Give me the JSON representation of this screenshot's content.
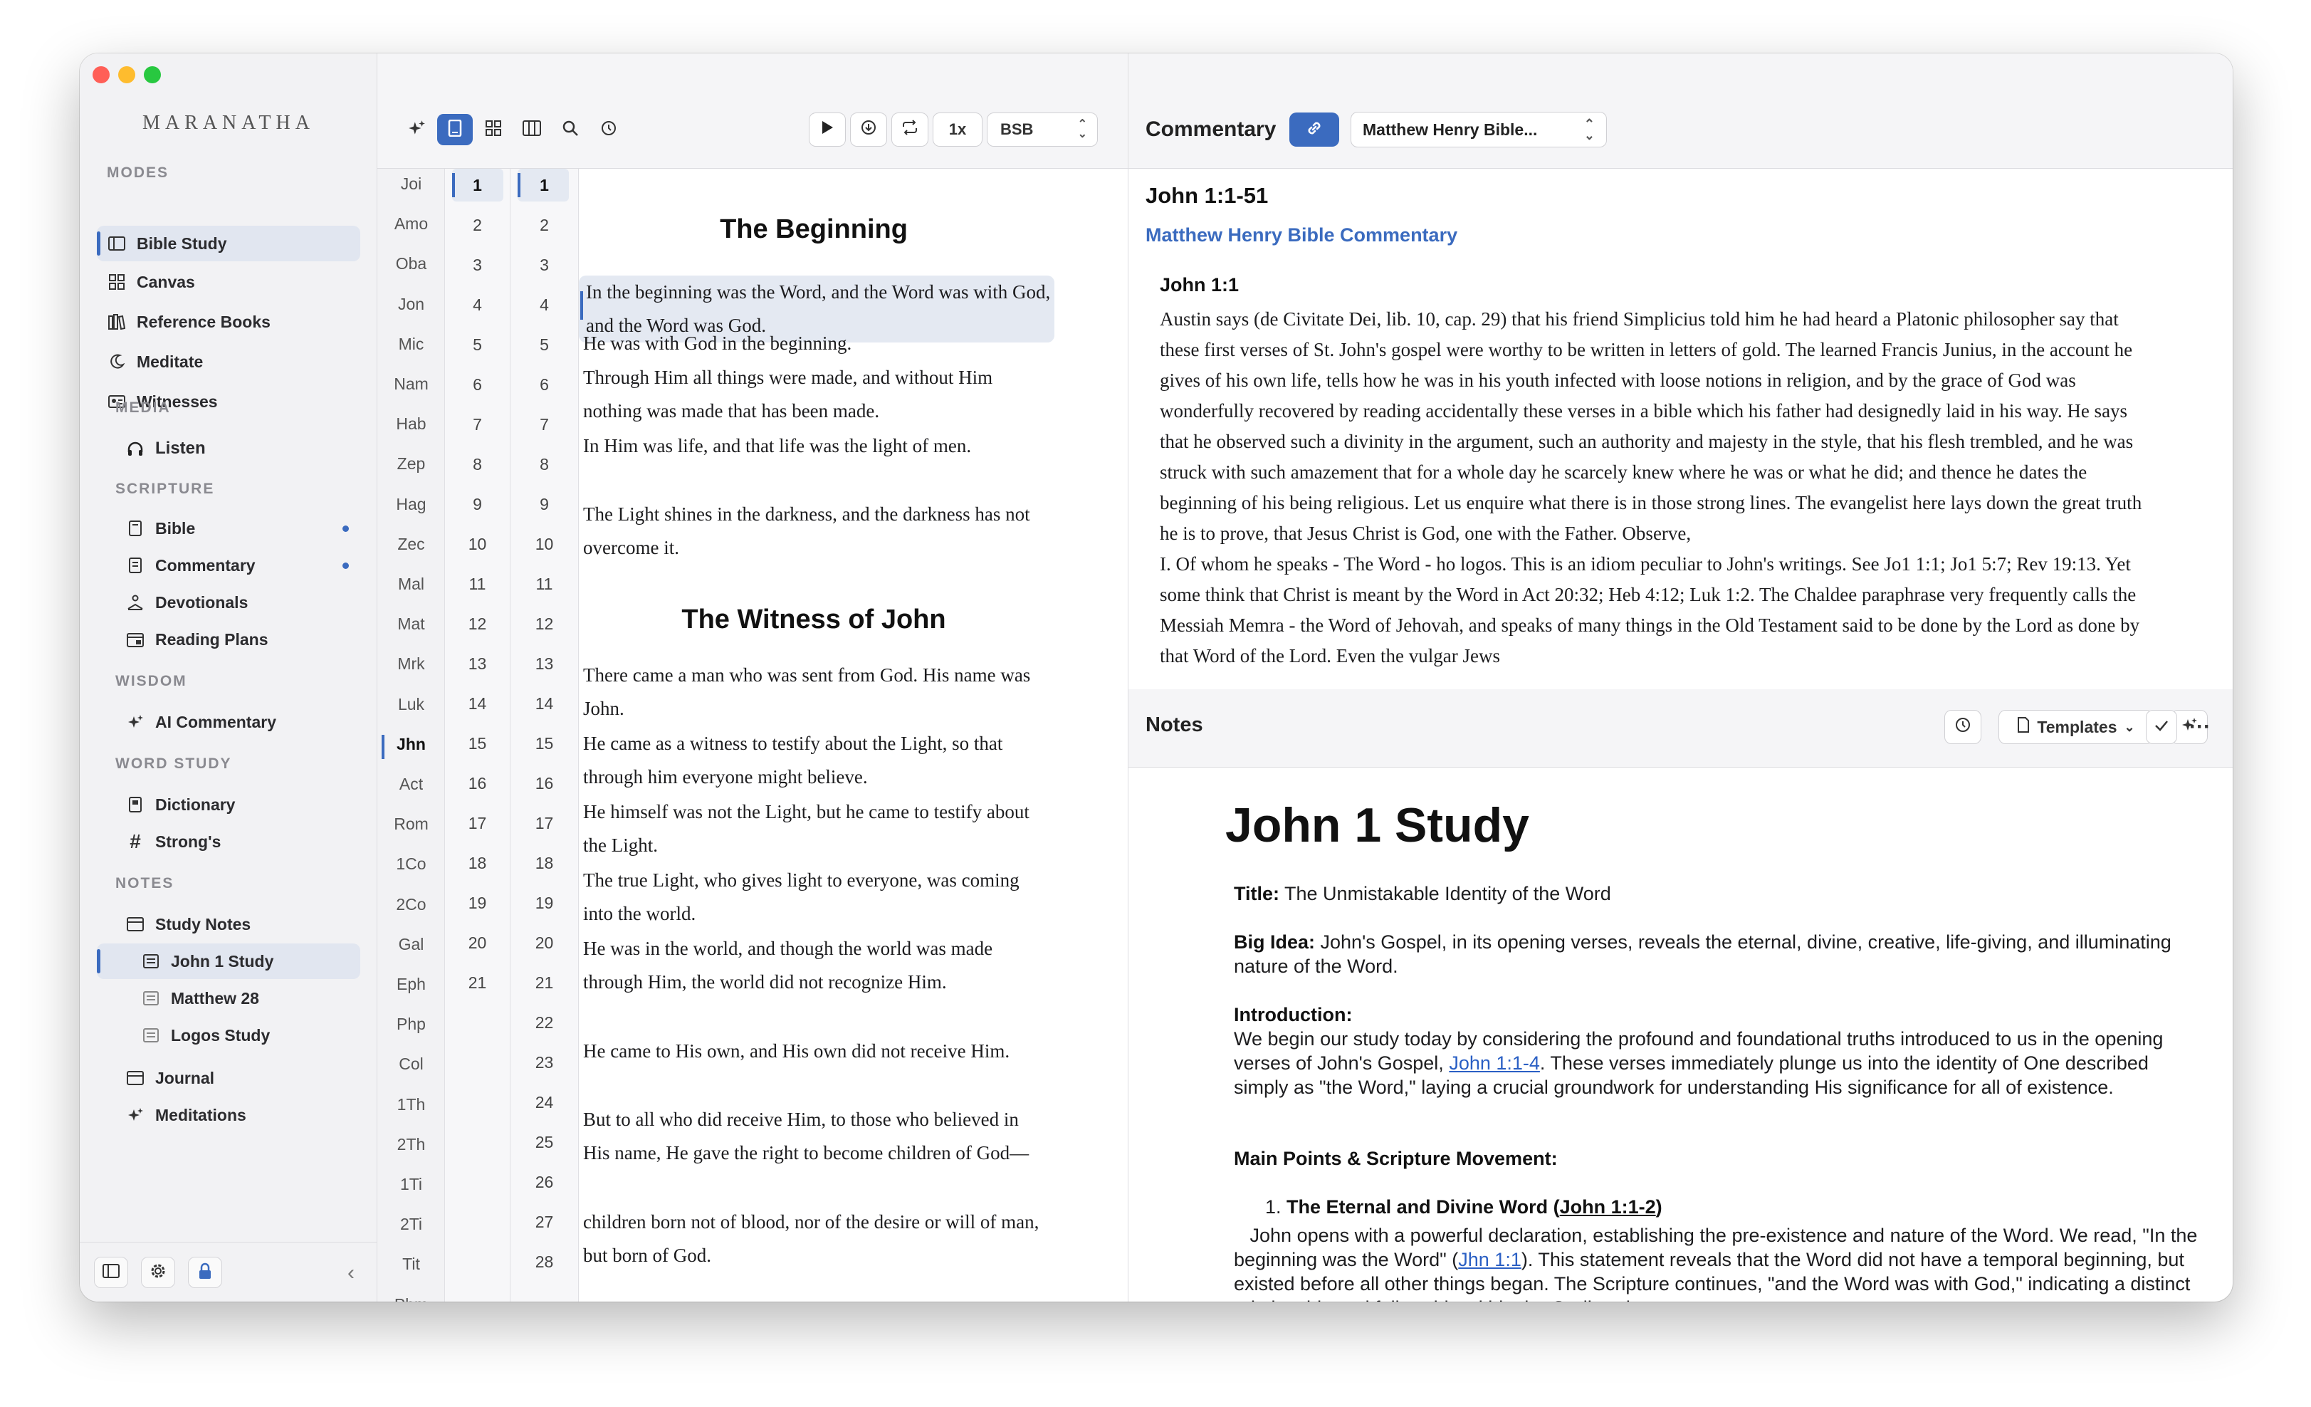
{
  "app": {
    "brand": "MARANATHA"
  },
  "sidebar": {
    "sections": {
      "modes": "MODES",
      "media": "MEDIA",
      "scripture": "SCRIPTURE",
      "wisdom": "WISDOM",
      "word_study": "WORD STUDY",
      "notes": "NOTES"
    },
    "modes": [
      "Bible Study",
      "Canvas",
      "Reference Books",
      "Meditate",
      "Witnesses"
    ],
    "media": [
      "Listen"
    ],
    "scripture": [
      "Bible",
      "Commentary",
      "Devotionals",
      "Reading Plans"
    ],
    "wisdom": [
      "AI Commentary"
    ],
    "word_study": [
      "Dictionary",
      "Strong's"
    ],
    "notes": {
      "folder": "Study Notes",
      "children": [
        "John 1 Study",
        "Matthew 28",
        "Logos Study"
      ],
      "others": [
        "Journal",
        "Meditations"
      ]
    }
  },
  "reader": {
    "speed": "1x",
    "translation": "BSB",
    "books": [
      "Joi",
      "Amo",
      "Oba",
      "Jon",
      "Mic",
      "Nam",
      "Hab",
      "Zep",
      "Hag",
      "Zec",
      "Mal",
      "Mat",
      "Mrk",
      "Luk",
      "Jhn",
      "Act",
      "Rom",
      "1Co",
      "2Co",
      "Gal",
      "Eph",
      "Php",
      "Col",
      "1Th",
      "2Th",
      "1Ti",
      "2Ti",
      "Tit",
      "Phm"
    ],
    "active_book": "Jhn",
    "chapters": [
      "1",
      "2",
      "3",
      "4",
      "5",
      "6",
      "7",
      "8",
      "9",
      "10",
      "11",
      "12",
      "13",
      "14",
      "15",
      "16",
      "17",
      "18",
      "19",
      "20",
      "21"
    ],
    "verse_numbers": [
      "1",
      "2",
      "3",
      "4",
      "5",
      "6",
      "7",
      "8",
      "9",
      "10",
      "11",
      "12",
      "13",
      "14",
      "15",
      "16",
      "17",
      "18",
      "19",
      "20",
      "21",
      "22",
      "23",
      "24",
      "25",
      "26",
      "27",
      "28"
    ],
    "headings": [
      "The Beginning",
      "The Witness of John"
    ],
    "verses": [
      "In the beginning was the Word, and the Word was with God, and the Word was God.",
      "He was with God in the beginning.",
      "Through Him all things were made, and without Him nothing was made that has been made.",
      "In Him was life, and that life was the light of men.",
      "The Light shines in the darkness, and the darkness has not overcome it.",
      "There came a man who was sent from God. His name was John.",
      "He came as a witness to testify about the Light, so that through him everyone might believe.",
      "He himself was not the Light, but he came to testify about the Light.",
      "The true Light, who gives light to everyone, was coming into the world.",
      "He was in the world, and though the world was made through Him, the world did not recognize Him.",
      "He came to His own, and His own did not receive Him.",
      "But to all who did receive Him, to those who believed in His name, He gave the right to become children of God—",
      "children born not of blood, nor of the desire or will of man, but born of God."
    ]
  },
  "commentary": {
    "title": "Commentary",
    "source_select": "Matthew Henry Bible...",
    "reference": "John 1:1-51",
    "source_name": "Matthew Henry Bible Commentary",
    "verse_heading": "John 1:1",
    "text": "Austin says (de Civitate Dei, lib. 10, cap. 29) that his friend Simplicius told him he had heard a Platonic philosopher say that these first verses of St. John's gospel were worthy to be written in letters of gold. The learned Francis Junius, in the account he gives of his own life, tells how he was in his youth infected with loose notions in religion, and by the grace of God was wonderfully recovered by reading accidentally these verses in a bible which his father had designedly laid in his way. He says that he observed such a divinity in the argument, such an authority and majesty in the style, that his flesh trembled, and he was struck with such amazement that for a whole day he scarcely knew where he was or what he did; and thence he dates the beginning of his being religious. Let us enquire what there is in those strong lines. The evangelist here lays down the great truth he is to prove, that Jesus Christ is God, one with the Father. Observe,",
    "text2": "I. Of whom he speaks - The Word - ho logos. This is an idiom peculiar to John's writings. See Jo1 1:1; Jo1 5:7; Rev 19:13. Yet some think that Christ is meant by the Word in Act 20:32; Heb 4:12; Luk 1:2. The Chaldee paraphrase very frequently calls the Messiah Memra - the Word of Jehovah, and speaks of many things in the Old Testament said to be done by the Lord as done by that Word of the Lord. Even the vulgar Jews"
  },
  "notes": {
    "title": "Notes",
    "templates_label": "Templates",
    "doc_title": "John 1 Study",
    "title_label": "Title:",
    "title_value": " The Unmistakable Identity of the Word",
    "big_idea_label": "Big Idea:",
    "big_idea_value": " John's Gospel, in its opening verses, reveals the eternal, divine, creative, life-giving, and illuminating nature of the Word.",
    "intro_label": "Introduction:",
    "intro_a": "We begin our study today by considering the profound and foundational truths introduced to us in the opening verses of John's Gospel, ",
    "intro_link": "John 1:1-4",
    "intro_b": ". These verses immediately plunge us into the identity of One described simply as \"the Word,\" laying a crucial groundwork for understanding His significance for all of existence.",
    "main_points_label": "Main Points & Scripture Movement:",
    "point1_num": "1.",
    "point1_label": "The Eternal and Divine Word (",
    "point1_link": "John 1:1-2",
    "point1_close": ")",
    "point1_a": "John opens with a powerful declaration, establishing the pre-existence and nature of the Word. We read, \"In the beginning was the Word\" (",
    "point1_ref": "Jhn 1:1",
    "point1_b": "). This statement reveals that the Word did not have a temporal beginning, but existed before all other things began. The Scripture continues, \"and the Word was with God,\" indicating a distinct relationship and fellowship within the Godhead."
  }
}
